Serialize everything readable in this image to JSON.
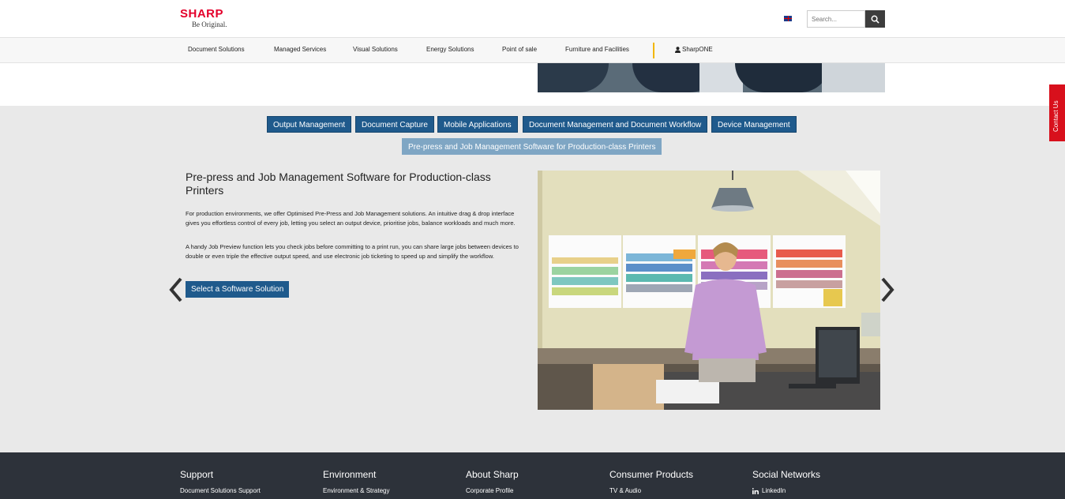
{
  "brand": {
    "name": "SHARP",
    "tagline": "Be Original."
  },
  "search": {
    "placeholder": "Search..."
  },
  "nav": {
    "items": [
      "Document Solutions",
      "Managed Services",
      "Visual Solutions",
      "Energy Solutions",
      "Point of sale",
      "Furniture and Facilities"
    ],
    "sharpone": "SharpONE"
  },
  "tabs": [
    "Output Management",
    "Document Capture",
    "Mobile Applications",
    "Document Management and Document Workflow",
    "Device Management",
    "Pre-press and Job Management Software for Production-class Printers"
  ],
  "active_tab": "Pre-press and Job Management Software for Production-class Printers",
  "content": {
    "title": "Pre-press and Job Management Software for Production-class Printers",
    "p1": "For production environments, we offer Optimised Pre-Press and Job Management solutions. An intuitive drag & drop interface gives you effortless control of every job, letting you select an output device, prioritise jobs, balance workloads and much more.",
    "p2": "A handy Job Preview function lets you check jobs before committing to a print run, you can share large jobs between devices to double or even triple the effective output speed, and use electronic job ticketing to speed up and simplify the workflow.",
    "cta": "Select a Software Solution"
  },
  "contact_tab": "Contact Us",
  "footer": {
    "columns": [
      {
        "heading": "Support",
        "link": "Document Solutions Support"
      },
      {
        "heading": "Environment",
        "link": "Environment & Strategy"
      },
      {
        "heading": "About Sharp",
        "link": "Corporate Profile"
      },
      {
        "heading": "Consumer Products",
        "link": "TV & Audio"
      },
      {
        "heading": "Social Networks",
        "link": "LinkedIn"
      }
    ]
  },
  "colors": {
    "brand_red": "#e4002b",
    "button_blue": "#1f5a8c",
    "active_tab": "#7fa6c4",
    "nav_separator": "#f2b700",
    "footer_bg": "#2d323a"
  }
}
